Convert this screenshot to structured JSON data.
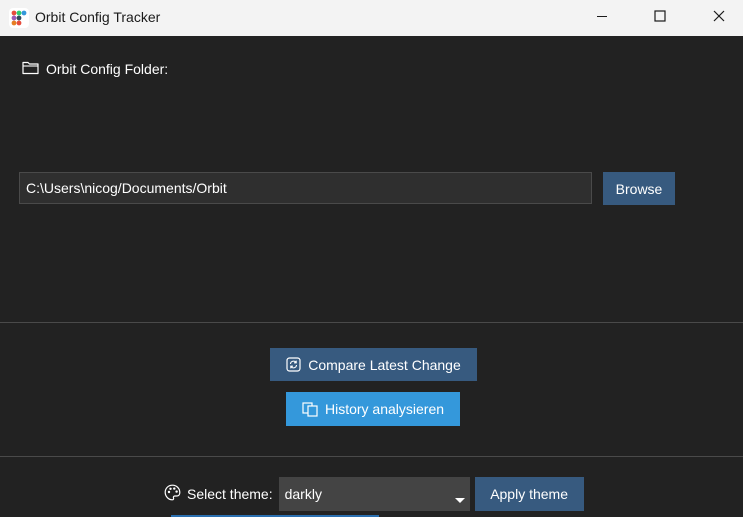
{
  "window": {
    "title": "Orbit Config Tracker",
    "app_icon": "colored-dots-icon",
    "controls": [
      "minimize-icon",
      "maximize-icon",
      "close-icon"
    ]
  },
  "folder_section": {
    "label": "Orbit Config Folder:",
    "icon": "folder-icon",
    "path_value": "C:\\Users\\nicog/Documents/Orbit",
    "browse_label": "Browse"
  },
  "actions": {
    "compare_label": "Compare Latest Change",
    "compare_icon": "refresh-icon",
    "history_label": "History analysieren",
    "history_icon": "copy-icon"
  },
  "theme": {
    "label": "Select theme:",
    "icon": "palette-icon",
    "selected": "darkly",
    "apply_label": "Apply theme"
  },
  "colors": {
    "background": "#222222",
    "primary": "#375a7f",
    "info": "#3498db",
    "input_bg": "#2f2f2f",
    "select_bg": "#444444"
  }
}
